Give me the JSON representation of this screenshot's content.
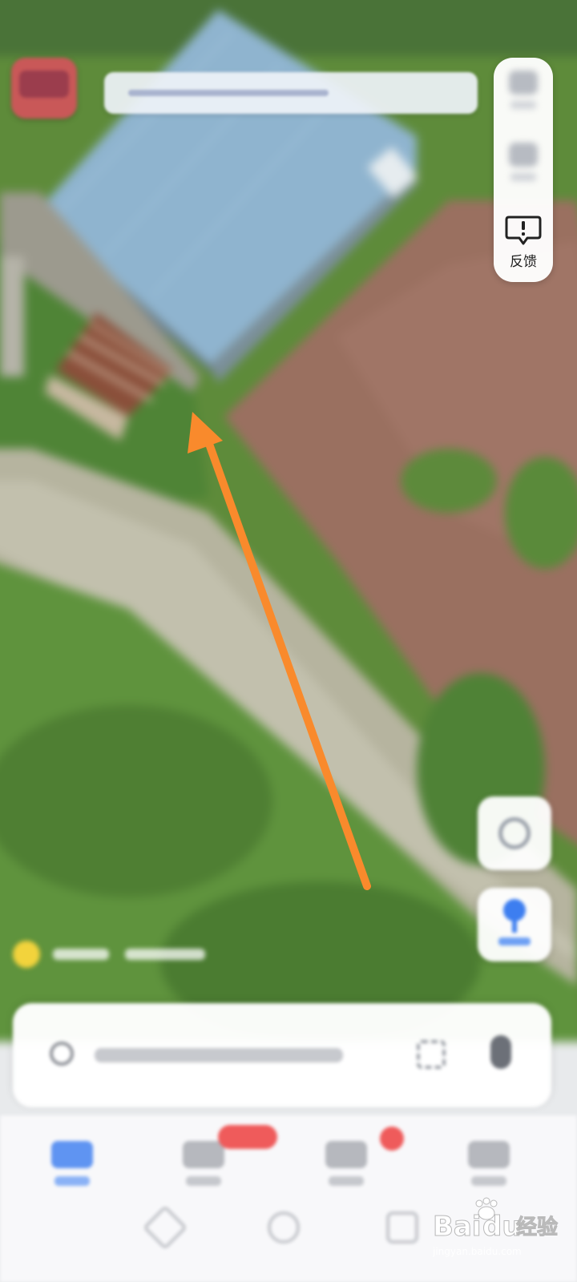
{
  "toolbar": {
    "feedback_label": "反馈"
  },
  "colors": {
    "arrow": "#f98a2c",
    "accent_blue": "#3d7ef0",
    "badge_red": "#ef5b5b"
  },
  "icons": {
    "feedback": "feedback-icon",
    "compass": "compass-icon",
    "location": "location-icon",
    "search": "search-icon",
    "scan": "scan-icon",
    "voice": "microphone-icon"
  },
  "watermark": {
    "brand": "Bai",
    "brand_suffix": "du",
    "brand_cn": "经验",
    "url": "jingyan.baidu.com"
  }
}
